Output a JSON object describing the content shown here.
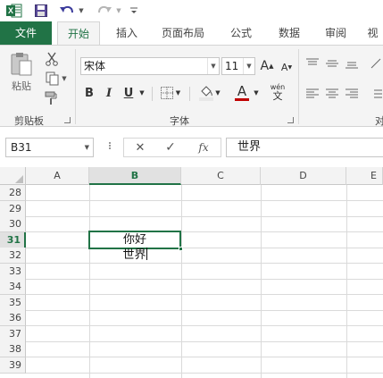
{
  "qat": {
    "app_icon": "excel-icon",
    "save_icon": "save-icon",
    "undo_icon": "undo-icon",
    "redo_icon": "redo-icon",
    "customize_icon": "customize-qat-icon"
  },
  "tabs": {
    "file": "文件",
    "home": "开始",
    "insert": "插入",
    "page_layout": "页面布局",
    "formulas": "公式",
    "data": "数据",
    "review": "审阅",
    "view": "视"
  },
  "ribbon": {
    "clipboard": {
      "label": "剪贴板",
      "paste": "粘贴"
    },
    "font": {
      "label": "字体",
      "font_name": "宋体",
      "font_size": "11",
      "bold": "B",
      "italic": "I",
      "underline": "U",
      "grow": "A",
      "shrink": "A",
      "font_color_letter": "A",
      "wen": "wén",
      "wen_char": "文"
    },
    "alignment": {
      "label_partial": "对"
    }
  },
  "formula_bar": {
    "name_box": "B31",
    "cancel": "✕",
    "enter": "✓",
    "fx": "fx",
    "content": "世界"
  },
  "grid": {
    "columns": [
      "A",
      "B",
      "C",
      "D",
      "E"
    ],
    "rows": [
      "28",
      "29",
      "30",
      "31",
      "32",
      "33",
      "34",
      "35",
      "36",
      "37",
      "38",
      "39"
    ],
    "active_cell_line1": "你好",
    "active_cell_line2": "世界"
  },
  "colors": {
    "accent": "#217346",
    "font_color_bar": "#c00000"
  }
}
